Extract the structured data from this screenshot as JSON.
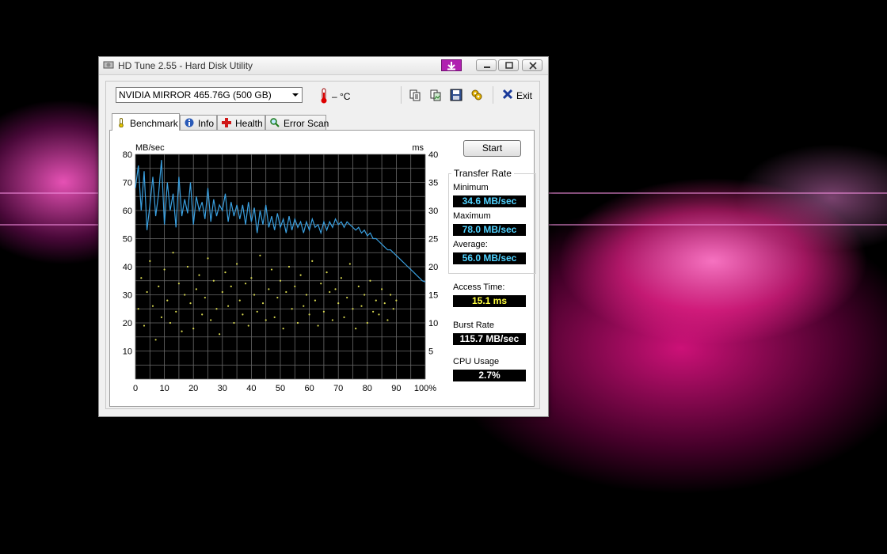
{
  "window": {
    "title": "HD Tune 2.55 - Hard Disk Utility"
  },
  "toolbar": {
    "drive_selected": "NVIDIA  MIRROR   465.76G (500 GB)",
    "temperature": "– °C",
    "exit_label": "Exit",
    "icons": [
      "copy-text-icon",
      "copy-image-icon",
      "save-icon",
      "options-icon",
      "exit-icon"
    ]
  },
  "tabs": [
    {
      "label": "Benchmark",
      "icon": "thermometer-icon",
      "active": true
    },
    {
      "label": "Info",
      "icon": "info-icon",
      "active": false
    },
    {
      "label": "Health",
      "icon": "health-cross-icon",
      "active": false
    },
    {
      "label": "Error Scan",
      "icon": "magnifier-icon",
      "active": false
    }
  ],
  "benchmark": {
    "start_label": "Start",
    "transfer_rate": {
      "title": "Transfer Rate",
      "minimum_label": "Minimum",
      "minimum": "34.6 MB/sec",
      "maximum_label": "Maximum",
      "maximum": "78.0 MB/sec",
      "average_label": "Average:",
      "average": "56.0 MB/sec"
    },
    "access_time_label": "Access Time:",
    "access_time": "15.1 ms",
    "burst_rate_label": "Burst Rate",
    "burst_rate": "115.7 MB/sec",
    "cpu_usage_label": "CPU Usage",
    "cpu_usage": "2.7%"
  },
  "chart_data": {
    "type": "line",
    "ylabel_left": "MB/sec",
    "ylabel_right": "ms",
    "ylim_left": [
      0,
      80
    ],
    "ylim_right": [
      0,
      40
    ],
    "x_ticks": [
      "0",
      "10",
      "20",
      "30",
      "40",
      "50",
      "60",
      "70",
      "80",
      "90",
      "100%"
    ],
    "y_ticks_left": [
      "80",
      "70",
      "60",
      "50",
      "40",
      "30",
      "20",
      "10"
    ],
    "y_ticks_right": [
      "40",
      "35",
      "30",
      "25",
      "20",
      "15",
      "10",
      "5"
    ],
    "grid": true,
    "colors": {
      "background": "#000000",
      "grid": "#6a6a6a",
      "transfer": "#3aa0e0",
      "access": "#d8d850"
    },
    "transfer_series": {
      "x": [
        0,
        1,
        2,
        3,
        4,
        5,
        6,
        7,
        8,
        9,
        10,
        11,
        12,
        13,
        14,
        15,
        16,
        17,
        18,
        19,
        20,
        21,
        22,
        23,
        24,
        25,
        26,
        27,
        28,
        29,
        30,
        31,
        32,
        33,
        34,
        35,
        36,
        37,
        38,
        39,
        40,
        41,
        42,
        43,
        44,
        45,
        46,
        47,
        48,
        49,
        50,
        51,
        52,
        53,
        54,
        55,
        56,
        57,
        58,
        59,
        60,
        61,
        62,
        63,
        64,
        65,
        66,
        67,
        68,
        69,
        70,
        71,
        72,
        73,
        74,
        75,
        76,
        77,
        78,
        79,
        80,
        81,
        82,
        83,
        84,
        85,
        86,
        87,
        88,
        89,
        90,
        91,
        92,
        93,
        94,
        95,
        96,
        97,
        98,
        99,
        100
      ],
      "y": [
        68,
        76,
        60,
        74,
        53,
        62,
        72,
        58,
        66,
        78,
        55,
        70,
        60,
        66,
        54,
        72,
        58,
        64,
        59,
        70,
        55,
        65,
        60,
        63,
        57,
        68,
        56,
        64,
        58,
        62,
        60,
        66,
        56,
        63,
        58,
        62,
        57,
        62,
        55,
        63,
        56,
        61,
        52,
        60,
        55,
        62,
        54,
        58,
        53,
        59,
        54,
        57,
        52,
        58,
        53,
        57,
        54,
        56,
        52,
        56,
        53,
        57,
        54,
        55,
        52,
        56,
        53,
        56,
        54,
        57,
        55,
        56,
        54,
        56,
        55,
        54,
        53,
        54,
        52,
        53,
        51,
        52,
        50,
        50,
        49,
        48,
        47,
        46,
        46,
        45,
        44,
        43,
        42,
        41,
        40,
        39,
        38,
        37,
        36,
        35,
        34.6
      ]
    },
    "access_series": {
      "x": [
        1,
        2,
        3,
        4,
        5,
        6,
        7,
        8,
        9,
        10,
        11,
        12,
        13,
        14,
        15,
        16,
        17,
        18,
        19,
        20,
        21,
        22,
        23,
        24,
        25,
        26,
        27,
        28,
        29,
        30,
        31,
        32,
        33,
        34,
        35,
        36,
        37,
        38,
        39,
        40,
        41,
        42,
        43,
        44,
        45,
        46,
        47,
        48,
        49,
        50,
        51,
        52,
        53,
        54,
        55,
        56,
        57,
        58,
        59,
        60,
        61,
        62,
        63,
        64,
        65,
        66,
        67,
        68,
        69,
        70,
        71,
        72,
        73,
        74,
        75,
        76,
        77,
        78,
        79,
        80,
        81,
        82,
        83,
        84,
        85,
        86,
        87,
        88,
        89,
        90
      ],
      "y": [
        12.5,
        18.0,
        9.5,
        15.5,
        21.0,
        13.0,
        7.0,
        16.5,
        11.0,
        19.5,
        14.0,
        10.0,
        22.5,
        12.0,
        17.0,
        8.5,
        15.0,
        20.0,
        13.5,
        9.0,
        16.0,
        18.5,
        11.5,
        14.5,
        21.5,
        10.5,
        17.5,
        12.5,
        8.0,
        15.5,
        19.0,
        13.0,
        16.5,
        10.0,
        20.5,
        14.0,
        11.5,
        17.0,
        9.5,
        18.0,
        15.0,
        12.0,
        22.0,
        13.5,
        10.5,
        16.0,
        19.5,
        11.0,
        14.5,
        17.5,
        9.0,
        15.5,
        20.0,
        12.5,
        16.5,
        10.0,
        18.5,
        13.0,
        15.0,
        11.5,
        21.0,
        14.0,
        9.5,
        17.0,
        12.0,
        19.0,
        15.5,
        10.5,
        16.0,
        13.5,
        18.0,
        11.0,
        14.5,
        20.5,
        12.5,
        9.0,
        16.5,
        13.0,
        15.0,
        10.0,
        17.5,
        12.0,
        14.0,
        11.5,
        16.0,
        13.5,
        10.5,
        15.0,
        12.5,
        14.0
      ]
    }
  }
}
